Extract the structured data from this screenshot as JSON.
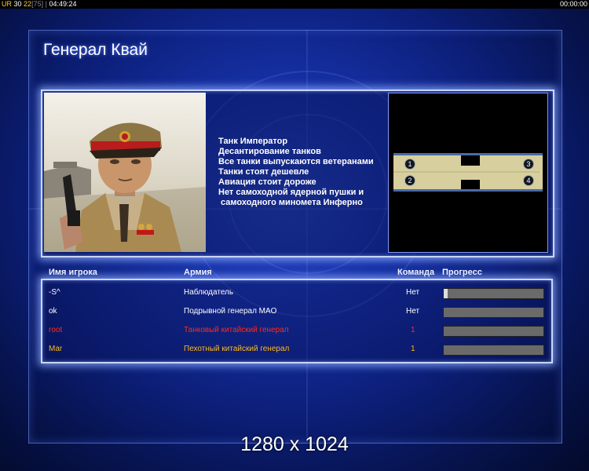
{
  "status_bar": {
    "ur_label": "UR",
    "value_a": "30",
    "value_b": "22",
    "bracket_value": "[75]",
    "sep": "|",
    "clock": "04:49:24",
    "timer": "00:00:00"
  },
  "general": {
    "name": "Генерал Квай",
    "features": [
      "Танк Император",
      "Десантирование танков",
      "Все танки выпускаются ветеранами",
      "Танки стоят дешевле",
      "Авиация стоит дороже",
      "Нет самоходной ядерной пушки и",
      " самоходного миномета Инферно"
    ]
  },
  "map": {
    "slots": [
      "1",
      "2",
      "3",
      "4"
    ]
  },
  "table": {
    "headers": {
      "player": "Имя игрока",
      "army": "Армия",
      "team": "Команда",
      "progress": "Прогресс"
    },
    "rows": [
      {
        "name": "-S^",
        "army": "Наблюдатель",
        "team": "Нет",
        "color": "#ffffff",
        "progress": 0.04
      },
      {
        "name": "ok",
        "army": "Подрывной генерал MAO",
        "team": "Нет",
        "color": "#ffffff",
        "progress": 0.0
      },
      {
        "name": "root",
        "army": "Танковый китайский генерал",
        "team": "1",
        "color": "#ff2a1a",
        "progress": 0.0
      },
      {
        "name": "Mar",
        "army": "Пехотный китайский генерал",
        "team": "1",
        "color": "#ffb81a",
        "progress": 0.0
      }
    ]
  },
  "resolution_text": "1280 x 1024",
  "colors": {
    "accent": "#c8d6ff",
    "background": "#1631a6"
  }
}
